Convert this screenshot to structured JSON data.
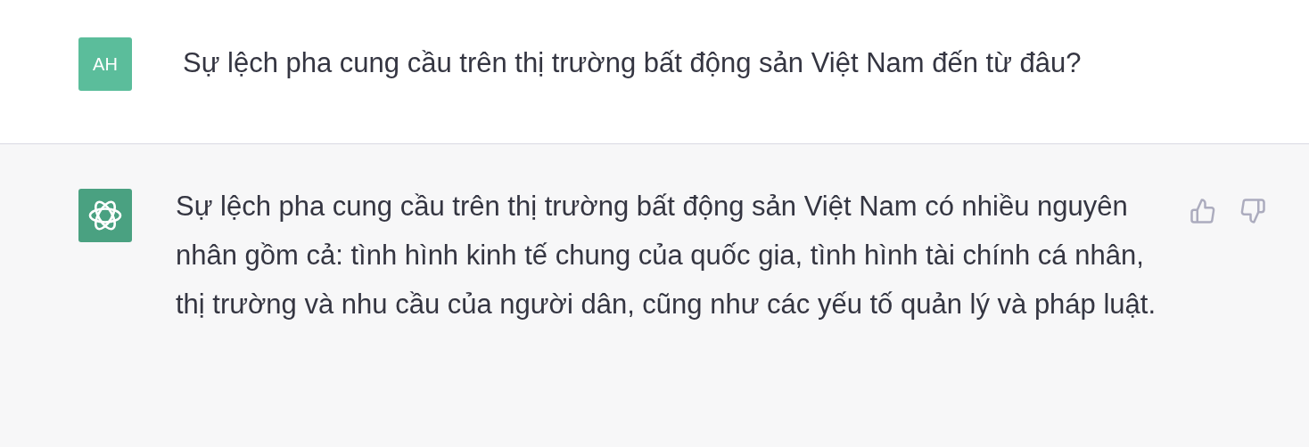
{
  "messages": [
    {
      "kind": "user",
      "avatar": "AH",
      "text": "Sự lệch pha cung cầu trên thị trường bất động sản Việt Nam đến từ đâu?"
    },
    {
      "kind": "assistant",
      "text": "Sự lệch pha cung cầu trên thị trường bất động sản Việt Nam có nhiều nguyên nhân gồm cả: tình hình kinh tế chung của quốc gia, tình hình tài chính cá nhân, thị trường và nhu cầu của người dân, cũng như các yếu tố quản lý và pháp luật."
    }
  ]
}
